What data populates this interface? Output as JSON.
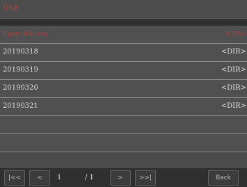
{
  "window": {
    "title": "USB"
  },
  "list": {
    "upper": {
      "label": "Upper directory",
      "type": "<DIR>"
    },
    "items": [
      {
        "name": "20190318",
        "type": "<DIR>"
      },
      {
        "name": "20190319",
        "type": "<DIR>"
      },
      {
        "name": "20190320",
        "type": "<DIR>"
      },
      {
        "name": "20190321",
        "type": "<DIR>"
      }
    ]
  },
  "pagination": {
    "first": "|<<",
    "prev": "<",
    "current_page": "1",
    "total_pages": "/ 1",
    "next": ">",
    "last": ">>|"
  },
  "footer": {
    "back_label": "Back"
  },
  "colors": {
    "accent_red": "#b83c3c",
    "background": "#4b4b4b",
    "footer": "#2f2f2f"
  }
}
